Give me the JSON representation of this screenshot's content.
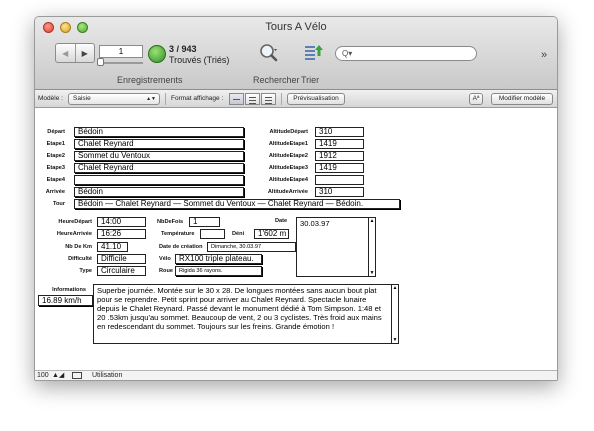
{
  "window": {
    "title": "Tours A Vélo"
  },
  "toolbar": {
    "record_number": "1",
    "found_total": "3 / 943",
    "found_label": "Trouvés (Triés)",
    "records_label": "Enregistrements",
    "find_label": "Rechercher",
    "sort_label": "Trier",
    "search_placeholder": "Q▾"
  },
  "layout_bar": {
    "layout_label": "Modèle :",
    "layout_value": "Saisie",
    "view_as_label": "Format affichage :",
    "preview_button": "Prévisualisation",
    "text_size_button": "Aª",
    "edit_layout_button": "Modifier modèle"
  },
  "form": {
    "labels": {
      "depart": "Départ",
      "etape1": "Etape1",
      "etape2": "Etape2",
      "etape3": "Etape3",
      "etape4": "Etape4",
      "arrivee": "Arrivée",
      "tour": "Tour",
      "alt_depart": "AltitudeDépart",
      "alt_etape1": "AltitudeEtape1",
      "alt_etape2": "AltitudeEtape2",
      "alt_etape3": "AltitudeEtape3",
      "alt_etape4": "AltitudeEtape4",
      "alt_arrivee": "AltitudeArrivée",
      "heure_depart": "HeureDépart",
      "heure_arrivee": "HeureArrivée",
      "nb_de_km": "Nb De Km",
      "difficulte": "Difficulté",
      "type": "Type",
      "nb_de_fois": "NbDeFois",
      "temperature": "Température",
      "deni": "Déni",
      "date_creation": "Date de création",
      "velo": "Vélo",
      "roue": "Roue",
      "date": "Date",
      "informations": "Informations"
    },
    "values": {
      "depart": "Bédoin",
      "etape1": "Chalet Reynard",
      "etape2": "Sommet du Ventoux",
      "etape3": "Chalet Reynard",
      "etape4": "",
      "arrivee": "Bédoin",
      "tour": "Bédoin — Chalet Reynard — Sommet du Ventoux — Chalet Reynard — Bédoin.",
      "alt_depart": "310",
      "alt_etape1": "1419",
      "alt_etape2": "1912",
      "alt_etape3": "1419",
      "alt_etape4": "",
      "alt_arrivee": "310",
      "heure_depart": "14:00",
      "heure_arrivee": "16:26",
      "nb_de_km": "41.10",
      "difficulte": "Difficile",
      "type": "Circulaire",
      "nb_de_fois": "1",
      "temperature": "",
      "deni": "1'602 m",
      "date_creation": "Dimanche, 30.03.97",
      "velo": "RX100 triple plateau.",
      "roue": "Rigida 36 rayons.",
      "date": "30.03.97",
      "vitesse": "16.89 km/h",
      "informations": "Superbe journée. Montée sur le 30 x 28. De longues montées sans aucun bout plat pour se reprendre. Petit sprint pour arriver au Chalet Reynard. Spectacle lunaire depuis le Chalet Reynard. Passé devant le monument dédié à Tom Simpson. 1:48 et 20 .53km jusqu'au sommet. Beaucoup de vent, 2 ou 3 cyclistes. Très froid aux mains en redescendant du sommet. Toujours sur les freins. Grande émotion !"
    }
  },
  "status": {
    "zoom": "100",
    "mode": "Utilisation"
  }
}
